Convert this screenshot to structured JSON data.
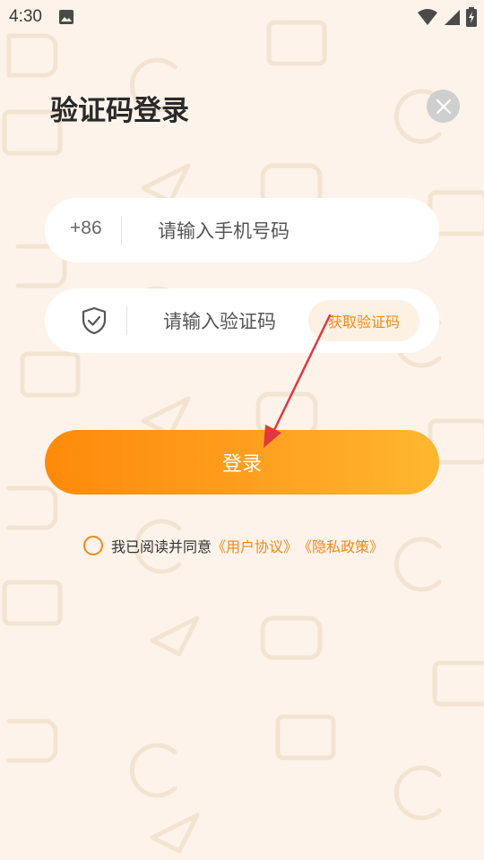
{
  "status_bar": {
    "time": "4:30",
    "icons": [
      "image-icon",
      "wifi-icon",
      "signal-icon",
      "battery-charging-icon"
    ]
  },
  "title": "验证码登录",
  "close_icon": "close-icon",
  "phone": {
    "prefix": "+86",
    "placeholder": "请输入手机号码",
    "value": ""
  },
  "code": {
    "icon": "shield-check-icon",
    "placeholder": "请输入验证码",
    "value": "",
    "get_code_label": "获取验证码"
  },
  "login_label": "登录",
  "agreement": {
    "prefix": "我已阅读并同意",
    "user_agreement": "《用户协议》",
    "privacy_policy": "《隐私政策》",
    "checked": false
  },
  "colors": {
    "accent": "#f08a1a",
    "background": "#fdf3ea",
    "button_gradient_start": "#ff8a0a",
    "button_gradient_end": "#ffb730",
    "annotation_arrow": "#e0383e"
  }
}
